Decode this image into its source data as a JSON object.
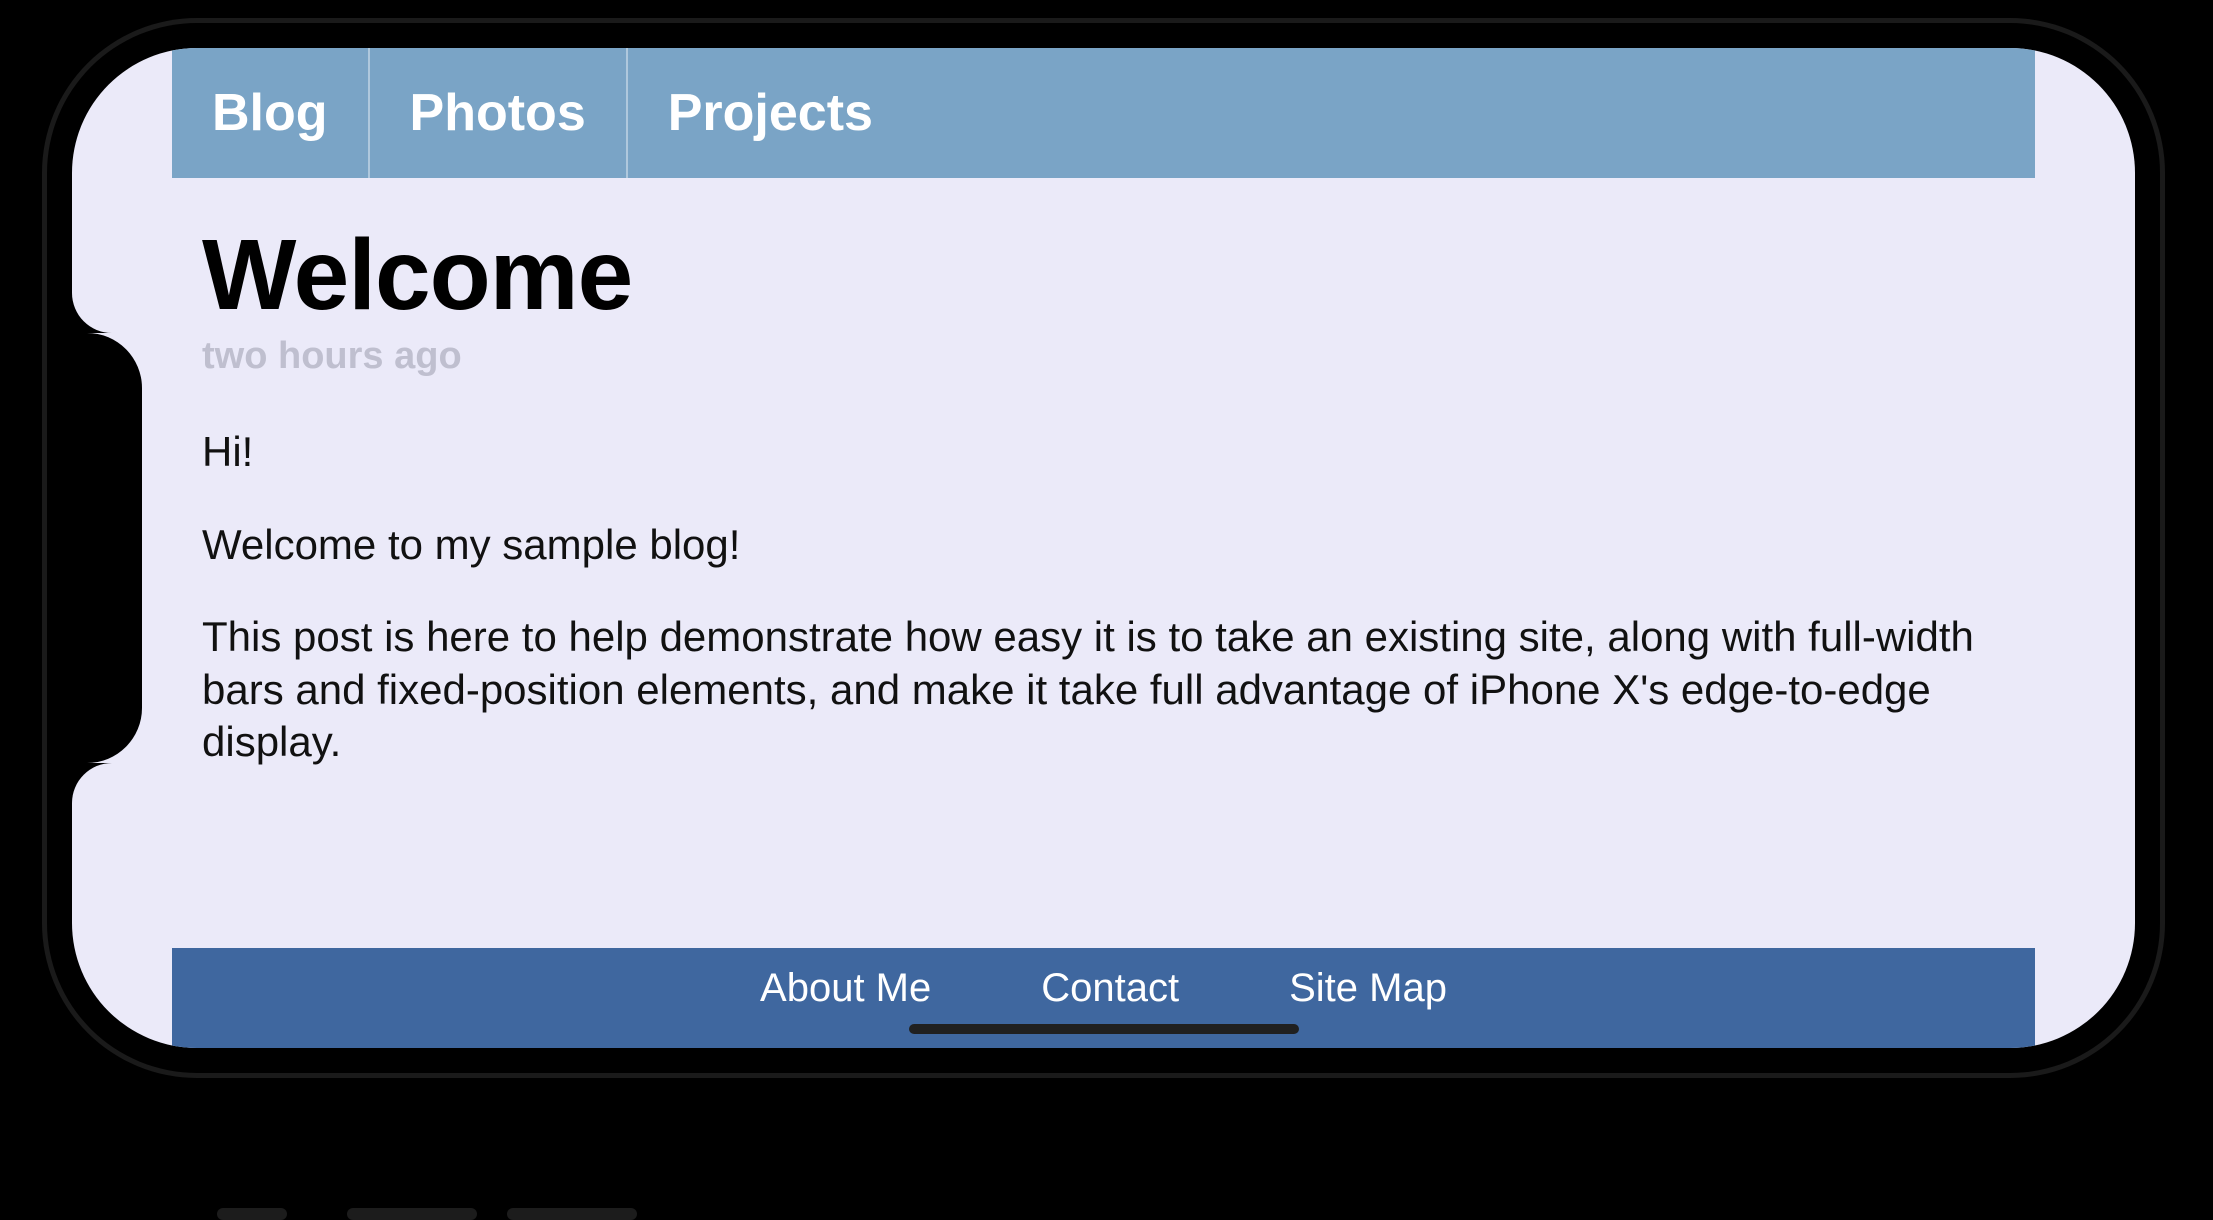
{
  "nav": {
    "items": [
      "Blog",
      "Photos",
      "Projects"
    ]
  },
  "post": {
    "title": "Welcome",
    "time": "two hours ago",
    "paragraphs": [
      "Hi!",
      "Welcome to my sample blog!",
      "This post is here to help demonstrate how easy it is to take an existing site, along with full-width bars and fixed-position elements, and make it take full advantage of iPhone X's edge-to-edge display."
    ]
  },
  "footer": {
    "items": [
      "About Me",
      "Contact",
      "Site Map"
    ]
  },
  "colors": {
    "page_bg": "#ebeaf9",
    "nav_bg": "#7aa4c6",
    "footer_bg": "#3f679f"
  }
}
